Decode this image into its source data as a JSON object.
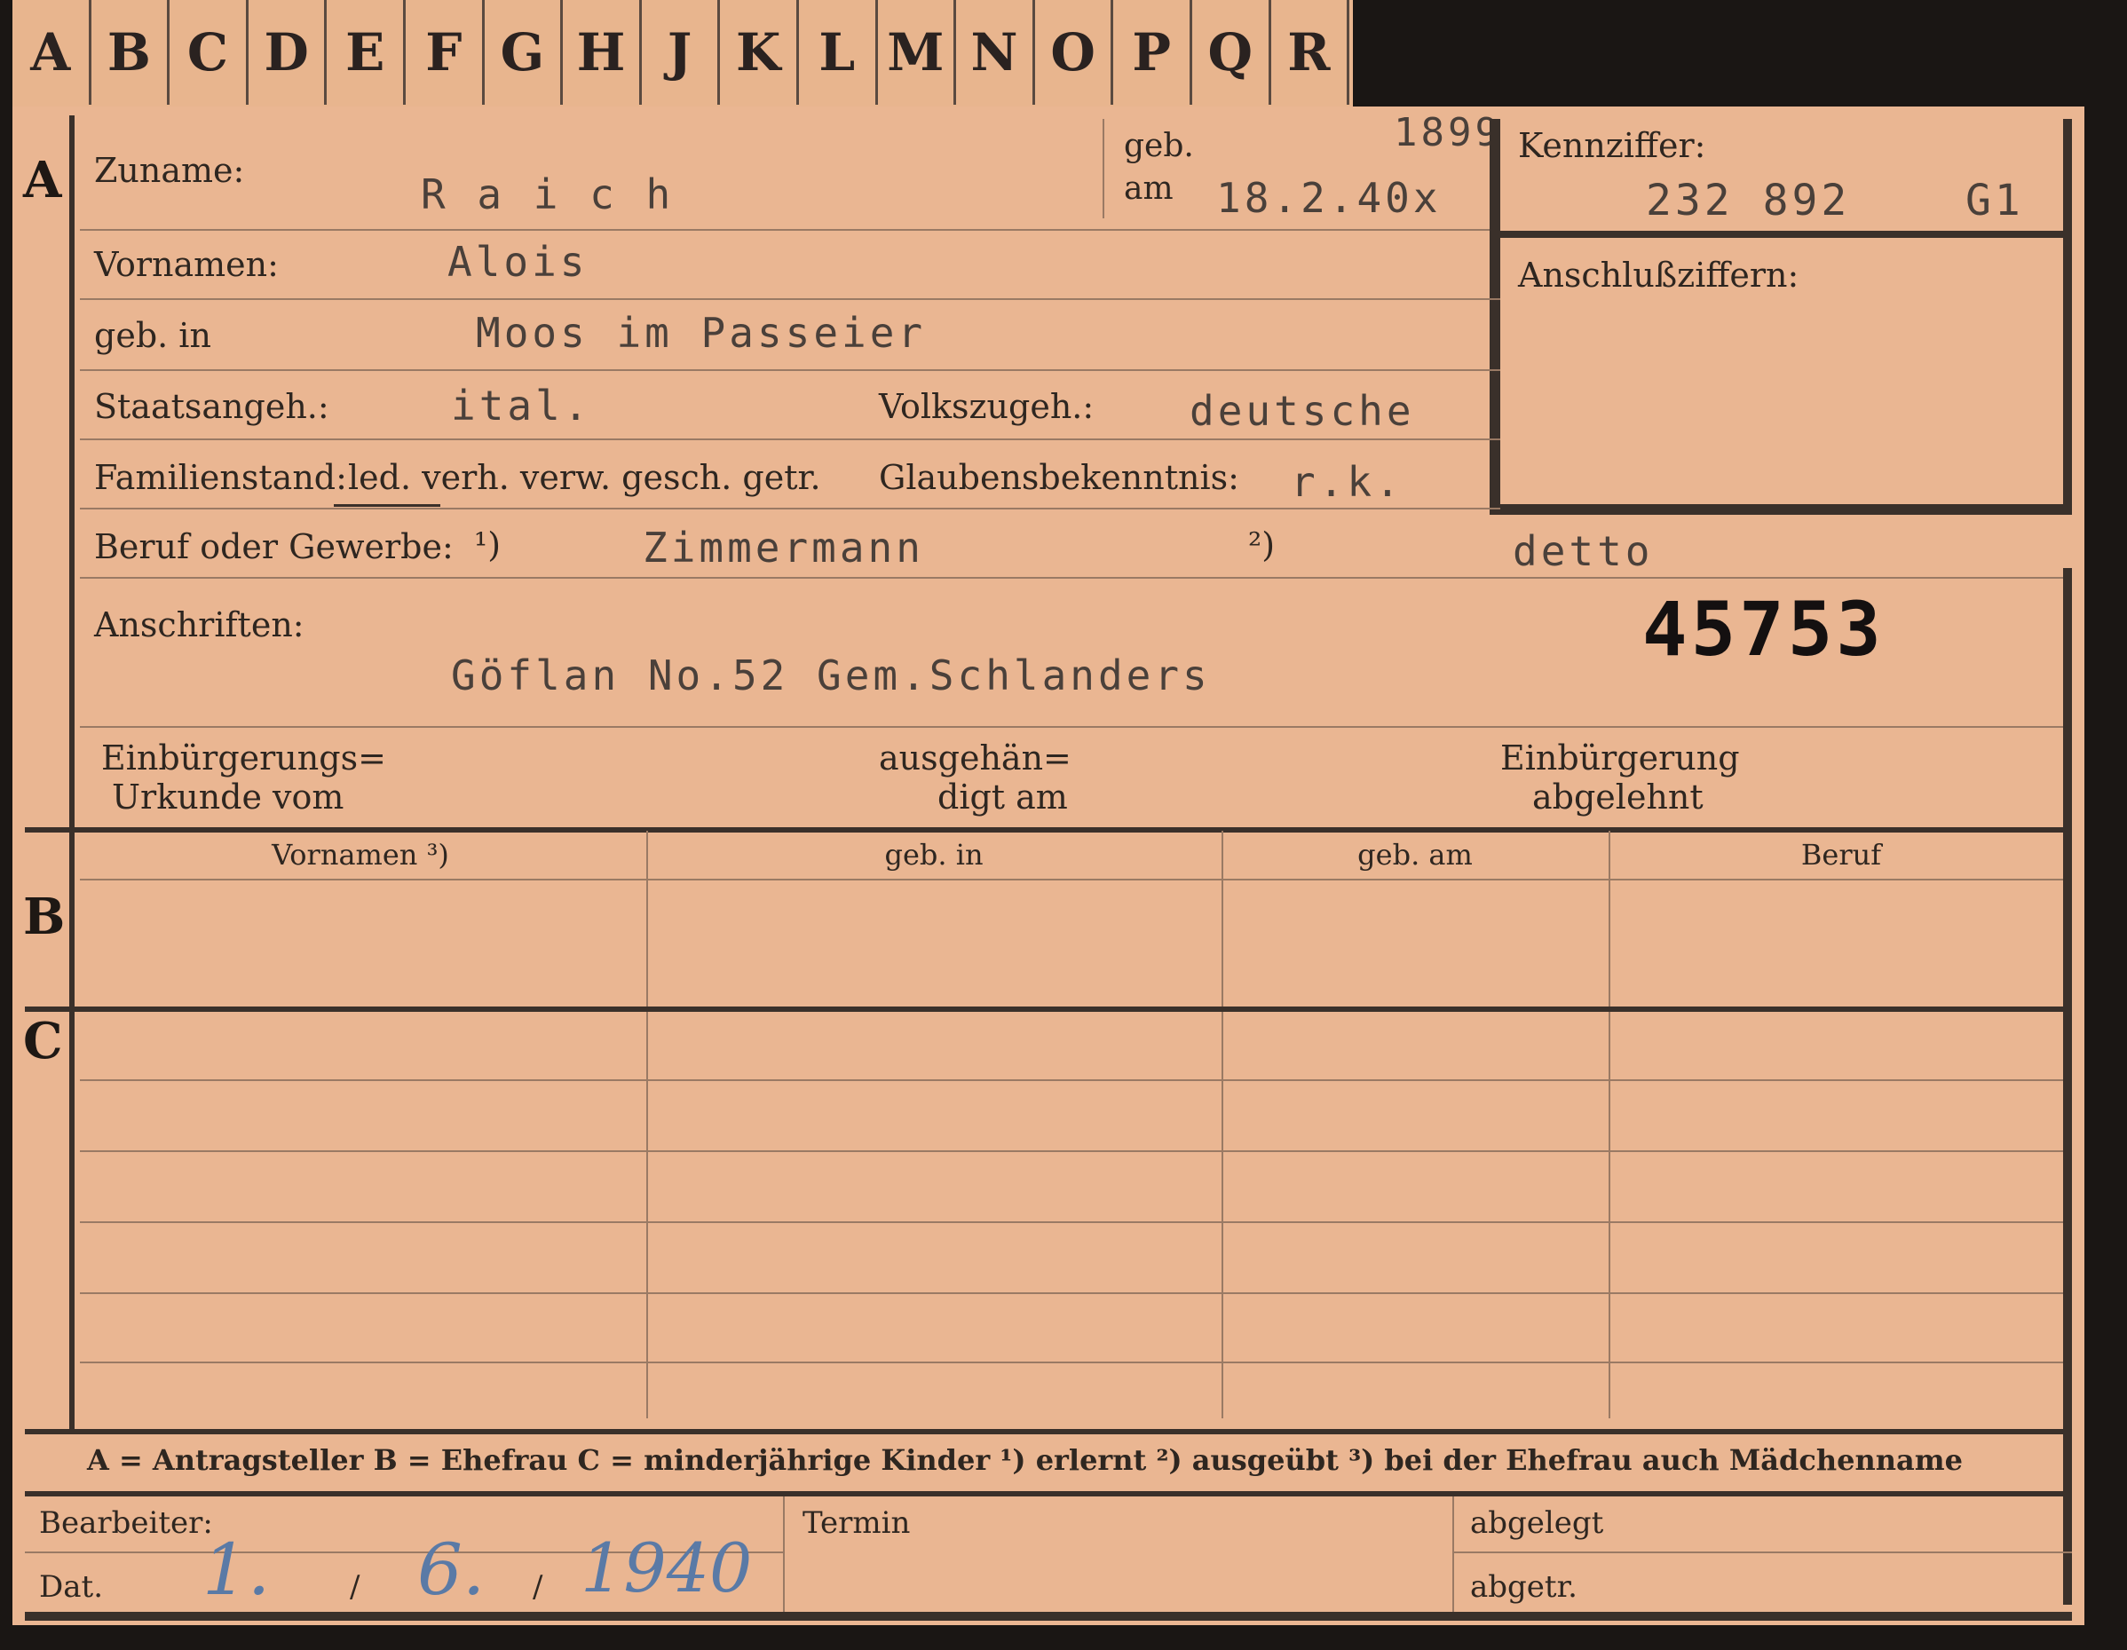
{
  "tabs": [
    "A",
    "B",
    "C",
    "D",
    "E",
    "F",
    "G",
    "H",
    "J",
    "K",
    "L",
    "M",
    "N",
    "O",
    "P",
    "Q",
    "R"
  ],
  "sections": {
    "a": "A",
    "b": "B",
    "c": "C"
  },
  "labels": {
    "zuname": "Zuname:",
    "geb_am_1": "geb.",
    "geb_am_2": "am",
    "kennziffer": "Kennziffer:",
    "anschlussziffern": "Anschlußziffern:",
    "vornamen": "Vornamen:",
    "geb_in": "geb. in",
    "staatsangeh": "Staatsangeh.:",
    "volkszugeh": "Volkszugeh.:",
    "familienstand": "Familienstand:",
    "familienstand_options": "led. verh. verw. gesch. getr.",
    "glaubensbekenntnis": "Glaubensbekenntnis:",
    "beruf": "Beruf oder Gewerbe:",
    "fn1": "¹)",
    "fn2": "²)",
    "anschriften": "Anschriften:",
    "einbuergerungs_1": "Einbürgerungs=",
    "einbuergerungs_2": "Urkunde vom",
    "ausgehaen_1": "ausgehän=",
    "ausgehaen_2": "digt am",
    "abgelehnt_1": "Einbürgerung",
    "abgelehnt_2": "abgelehnt"
  },
  "values": {
    "zuname": "R a i c h",
    "geb_am": "18.2.40x",
    "geb_year": "1899",
    "kennziffer": "232 892",
    "kennziffer_suffix": "G1",
    "vornamen": "Alois",
    "geb_in": "Moos im Passeier",
    "staatsangeh": "ital.",
    "volkszugeh": "deutsche",
    "glaubensbekenntnis": "r.k.",
    "beruf_erlernt": "Zimmermann",
    "beruf_ausgeuebt": "detto",
    "stamp_number": "45753",
    "anschrift": "Göflan  No.52  Gem.Schlanders"
  },
  "table_headers": [
    "Vornamen ³)",
    "geb. in",
    "geb. am",
    "Beruf"
  ],
  "legend": "A = Antragsteller   B = Ehefrau   C = minderjährige Kinder   ¹) erlernt   ²) ausgeübt   ³) bei der Ehefrau auch Mädchenname",
  "footer": {
    "bearbeiter": "Bearbeiter:",
    "dat": "Dat.",
    "termin": "Termin",
    "abgelegt": "abgelegt",
    "abgetr": "abgetr.",
    "date_day": "1.",
    "date_sep1": "/",
    "date_month": "6.",
    "date_sep2": "/",
    "date_year": "1940"
  },
  "colors": {
    "card": "#eab692",
    "ink": "#2e2620",
    "typewriter": "#4a403a",
    "handwriting": "#5a7aa6"
  }
}
